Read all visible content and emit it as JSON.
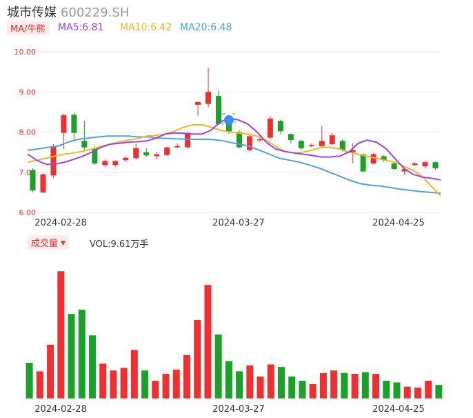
{
  "header": {
    "name": "城市传媒",
    "code": "600229.SH"
  },
  "legend": {
    "ma_tag": "MA/牛熊",
    "ma5": "MA5:6.81",
    "ma10": "MA10:6.42",
    "ma20": "MA20:6.48",
    "vol_tag": "成交量",
    "vol_text": "VOL:9.61万手"
  },
  "colors": {
    "up": "#f03030",
    "down": "#1aa128",
    "ma5": "#a040f0",
    "ma10": "#f0b820",
    "ma20": "#4aa3e8",
    "grid": "#e8e8e8",
    "axis_label": "#e8332b"
  },
  "chart_data": [
    {
      "type": "candlestick",
      "ylim": [
        6.0,
        10.0
      ],
      "yticks": [
        "10.00",
        "9.00",
        "8.00",
        "7.00",
        "6.00"
      ],
      "xlabels": [
        "2024-02-28",
        "2024-03-27",
        "2024-04-25"
      ],
      "candles": [
        {
          "o": 7.05,
          "c": 6.55,
          "h": 7.1,
          "l": 6.5
        },
        {
          "o": 6.5,
          "c": 6.95,
          "h": 6.97,
          "l": 6.48
        },
        {
          "o": 6.92,
          "c": 7.65,
          "h": 7.7,
          "l": 6.85
        },
        {
          "o": 7.98,
          "c": 8.42,
          "h": 8.45,
          "l": 7.58
        },
        {
          "o": 8.43,
          "c": 7.98,
          "h": 8.48,
          "l": 7.8
        },
        {
          "o": 7.78,
          "c": 7.62,
          "h": 8.28,
          "l": 7.55
        },
        {
          "o": 7.6,
          "c": 7.22,
          "h": 7.65,
          "l": 7.18
        },
        {
          "o": 7.18,
          "c": 7.28,
          "h": 7.32,
          "l": 7.12
        },
        {
          "o": 7.18,
          "c": 7.28,
          "h": 7.3,
          "l": 7.13
        },
        {
          "o": 7.3,
          "c": 7.36,
          "h": 7.4,
          "l": 7.26
        },
        {
          "o": 7.35,
          "c": 7.6,
          "h": 7.7,
          "l": 7.32
        },
        {
          "o": 7.5,
          "c": 7.42,
          "h": 7.6,
          "l": 7.38
        },
        {
          "o": 7.4,
          "c": 7.45,
          "h": 7.5,
          "l": 7.32
        },
        {
          "o": 7.43,
          "c": 7.62,
          "h": 7.63,
          "l": 7.4
        },
        {
          "o": 7.62,
          "c": 7.65,
          "h": 7.72,
          "l": 7.6
        },
        {
          "o": 7.62,
          "c": 7.98,
          "h": 8.0,
          "l": 7.6
        },
        {
          "o": 8.68,
          "c": 8.75,
          "h": 8.76,
          "l": 8.4
        },
        {
          "o": 8.7,
          "c": 9.0,
          "h": 9.6,
          "l": 8.62
        },
        {
          "o": 8.9,
          "c": 8.2,
          "h": 9.05,
          "l": 8.18
        },
        {
          "o": 8.25,
          "c": 8.02,
          "h": 8.42,
          "l": 7.95
        },
        {
          "o": 8.0,
          "c": 7.62,
          "h": 8.05,
          "l": 7.6
        },
        {
          "o": 7.55,
          "c": 7.9,
          "h": 7.92,
          "l": 7.52
        },
        {
          "o": 7.8,
          "c": 7.82,
          "h": 7.85,
          "l": 7.75
        },
        {
          "o": 7.86,
          "c": 8.34,
          "h": 8.4,
          "l": 7.82
        },
        {
          "o": 8.28,
          "c": 8.02,
          "h": 8.3,
          "l": 7.95
        },
        {
          "o": 7.95,
          "c": 7.8,
          "h": 7.96,
          "l": 7.72
        },
        {
          "o": 7.78,
          "c": 7.6,
          "h": 7.82,
          "l": 7.55
        },
        {
          "o": 7.65,
          "c": 7.68,
          "h": 7.72,
          "l": 7.62
        },
        {
          "o": 7.65,
          "c": 7.78,
          "h": 8.15,
          "l": 7.62
        },
        {
          "o": 7.7,
          "c": 7.92,
          "h": 7.98,
          "l": 7.68
        },
        {
          "o": 7.78,
          "c": 7.55,
          "h": 7.82,
          "l": 7.5
        },
        {
          "o": 7.5,
          "c": 7.55,
          "h": 7.72,
          "l": 7.22
        },
        {
          "o": 7.45,
          "c": 7.02,
          "h": 7.47,
          "l": 7.0
        },
        {
          "o": 7.22,
          "c": 7.45,
          "h": 7.48,
          "l": 7.2
        },
        {
          "o": 7.4,
          "c": 7.3,
          "h": 7.42,
          "l": 7.26
        },
        {
          "o": 7.22,
          "c": 7.08,
          "h": 7.25,
          "l": 7.05
        },
        {
          "o": 7.02,
          "c": 7.08,
          "h": 7.12,
          "l": 6.94
        },
        {
          "o": 7.18,
          "c": 7.22,
          "h": 7.25,
          "l": 7.15
        },
        {
          "o": 7.15,
          "c": 7.25,
          "h": 7.27,
          "l": 7.1
        },
        {
          "o": 7.25,
          "c": 7.1,
          "h": 7.27,
          "l": 7.06
        }
      ],
      "ma5": [
        7.45,
        7.3,
        7.2,
        7.2,
        7.25,
        7.32,
        7.4,
        7.5,
        7.62,
        7.7,
        7.72,
        7.75,
        7.76,
        7.78,
        7.85,
        7.95,
        7.98,
        7.97,
        7.95,
        7.95,
        8.05,
        8.25,
        8.35,
        8.3,
        8.2,
        8.0,
        7.75,
        7.58,
        7.52,
        7.48,
        7.45,
        7.42,
        7.38,
        7.38,
        7.4,
        7.5,
        7.72,
        7.8,
        7.75,
        7.6,
        7.35,
        7.1,
        6.95,
        6.88,
        6.85,
        6.81
      ],
      "ma10": [
        7.25,
        7.3,
        7.35,
        7.4,
        7.45,
        7.48,
        7.52,
        7.58,
        7.64,
        7.7,
        7.76,
        7.8,
        7.84,
        7.9,
        7.92,
        7.95,
        8.02,
        8.12,
        8.18,
        8.18,
        8.12,
        8.05,
        8.0,
        7.98,
        7.95,
        7.9,
        7.8,
        7.65,
        7.52,
        7.48,
        7.5,
        7.55,
        7.62,
        7.62,
        7.58,
        7.5,
        7.45,
        7.4,
        7.35,
        7.3,
        7.25,
        7.15,
        7.05,
        6.9,
        6.65,
        6.42
      ],
      "ma20": [
        7.55,
        7.58,
        7.62,
        7.65,
        7.75,
        7.82,
        7.85,
        7.88,
        7.9,
        7.9,
        7.9,
        7.88,
        7.88,
        7.85,
        7.84,
        7.83,
        7.82,
        7.82,
        7.82,
        7.8,
        7.75,
        7.7,
        7.65,
        7.55,
        7.45,
        7.35,
        7.3,
        7.25,
        7.18,
        7.1,
        7.0,
        6.9,
        6.8,
        6.72,
        6.68,
        6.66,
        6.62,
        6.58,
        6.55,
        6.52,
        6.5,
        6.48
      ]
    },
    {
      "type": "bar",
      "title": "成交量",
      "xlabels": [
        "2024-02-28",
        "2024-03-27",
        "2024-04-25"
      ],
      "volumes": [
        4.2,
        3.2,
        6.3,
        14.9,
        9.9,
        10.4,
        7.4,
        4.1,
        3.3,
        3.6,
        5.7,
        3.3,
        2.1,
        2.9,
        3.4,
        5.1,
        9.2,
        13.3,
        7.5,
        4.4,
        3.2,
        3.9,
        2.6,
        4.0,
        3.7,
        2.6,
        2.1,
        1.7,
        3.0,
        3.3,
        3.0,
        2.9,
        3.1,
        2.9,
        2.1,
        1.9,
        1.4,
        1.3,
        2.1,
        1.6
      ],
      "ylim": [
        0,
        15
      ]
    }
  ]
}
